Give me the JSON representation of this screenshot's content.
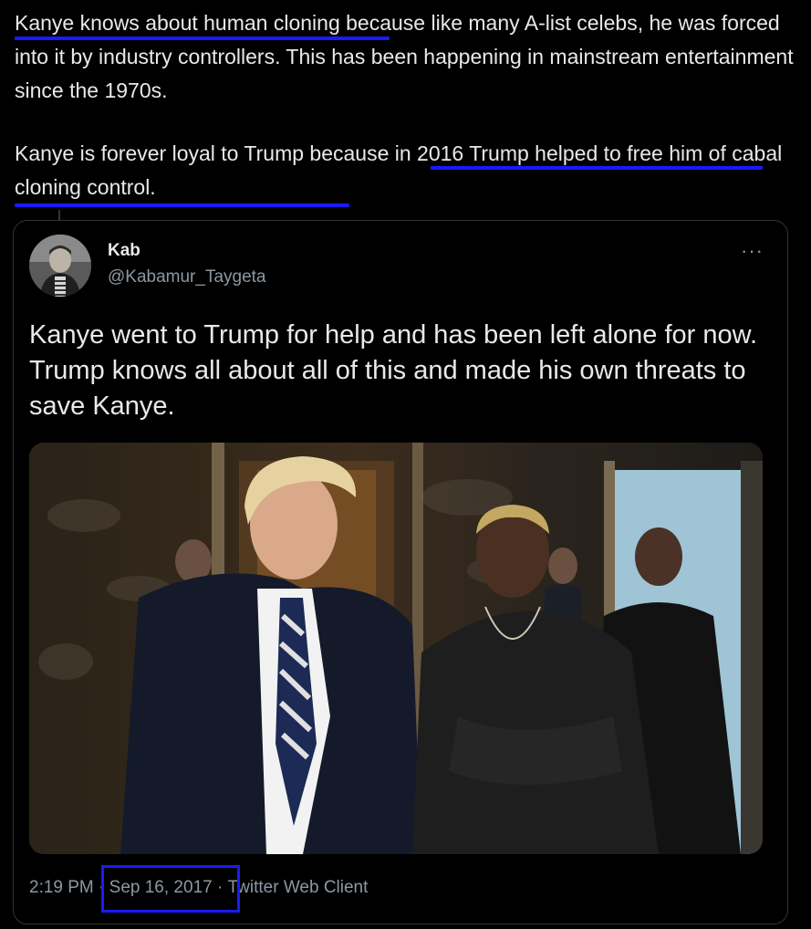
{
  "commentary": {
    "paragraph1": "Kanye knows about human cloning because like many A-list celebs, he was forced into it by industry controllers. This has been happening in mainstream entertainment since the 1970s.",
    "paragraph2": "Kanye is forever loyal to Trump because in 2016 Trump helped to free him of cabal cloning control."
  },
  "tweet": {
    "author_name": "Kab",
    "author_handle": "@Kabamur_Taygeta",
    "more_label": "···",
    "text": "Kanye went to Trump for help and has been left alone for now. Trump knows all about all of this and made his own threats to save Kanye.",
    "time": "2:19 PM",
    "separator": "·",
    "date": "Sep 16, 2017",
    "source": "Twitter Web Client"
  },
  "colors": {
    "highlight_annotation": "#1a1aff",
    "background": "#000000",
    "text_primary": "#e7e9ea",
    "text_secondary": "#8b98a5",
    "card_border": "#2f3336"
  }
}
